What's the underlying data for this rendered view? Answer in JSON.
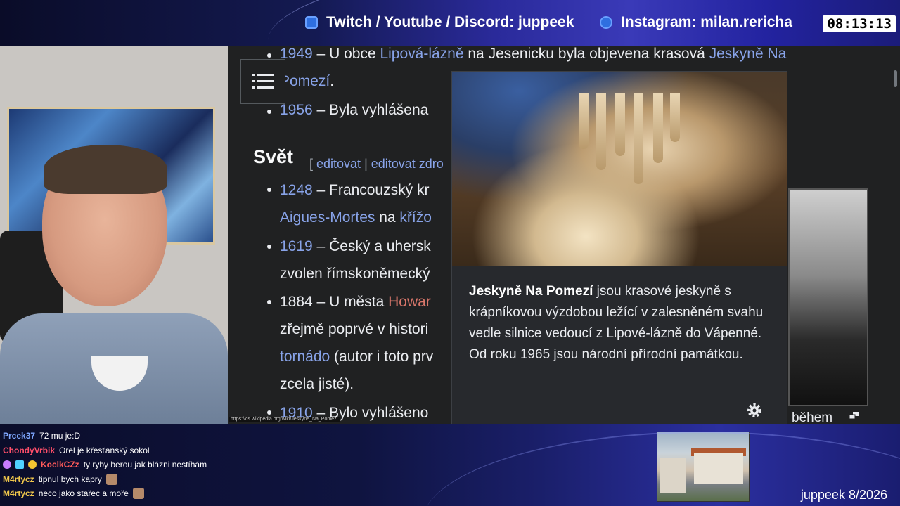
{
  "overlay": {
    "socials": [
      {
        "icon": "twitch-icon",
        "text": "Twitch / Youtube / Discord: juppeek"
      },
      {
        "icon": "instagram-icon",
        "text": "Instagram: milan.rericha"
      }
    ],
    "clock": "08:13:13",
    "caption": "juppeek 8/2026"
  },
  "article": {
    "lines": [
      {
        "pre": "1949",
        "text1": " – U obce ",
        "link1": "Lipová-lázně",
        "text2": " na Jesenicku byla objevena krasová ",
        "link2": "Jeskyně Na"
      },
      {
        "link1": "Pomezí",
        "text1": "."
      },
      {
        "pre": "1956",
        "text1": " – Byla vyhlášena"
      }
    ],
    "section_title": "Svět",
    "edit_links": [
      "editovat",
      "editovat zdro"
    ],
    "world_lines": [
      {
        "pre": "1248",
        "text1": " – Francouzský kr"
      },
      {
        "link1": "Aigues-Mortes",
        "text1": " na ",
        "link2": "křížo"
      },
      {
        "pre": "1619",
        "text1": " – Český a uhersk"
      },
      {
        "text1": "zvolen římskoněmecký"
      },
      {
        "plain": "1884",
        "text1": " – U města ",
        "red": "Howar"
      },
      {
        "text1": "zřejmě poprvé v histori"
      },
      {
        "link1": "tornádo",
        "text1": " (autor i toto prv"
      },
      {
        "text1": "zcela jisté)."
      },
      {
        "pre": "1910",
        "text1": " – Bylo vyhlášeno"
      }
    ],
    "status_url": "https://cs.wikipedia.org/wiki/Jeskyně_Na_Pomezí"
  },
  "popup": {
    "title": "Jeskyně Na Pomezí",
    "text": " jsou krasové jeskyně s krápníkovou výzdobou ležící v zalesněném svahu vedle silnice vedoucí z Lipové-lázně do Vápenné. Od roku 1965 jsou národní přírodní památkou."
  },
  "side_caption": "během",
  "chat": [
    {
      "user": "Prcek37",
      "color": "#7fa7ff",
      "msg": "72 mu je:D",
      "badges": [],
      "emote": false
    },
    {
      "user": "ChondyVrbik",
      "color": "#ff4f6a",
      "msg": "Orel je křesťanský sokol",
      "badges": [],
      "emote": false
    },
    {
      "user": "KoclkCZz",
      "color": "#ff5a5a",
      "msg": "ty ryby berou jak blázni nestíhám",
      "badges": [
        "#c97cff",
        "#4fd2ff",
        "#f3c531"
      ],
      "emote": false
    },
    {
      "user": "M4rtycz",
      "color": "#f2c94c",
      "msg": "tipnul bych kapry",
      "badges": [],
      "emote": true
    },
    {
      "user": "M4rtycz",
      "color": "#f2c94c",
      "msg": "neco jako stařec a moře",
      "badges": [],
      "emote": true
    }
  ]
}
